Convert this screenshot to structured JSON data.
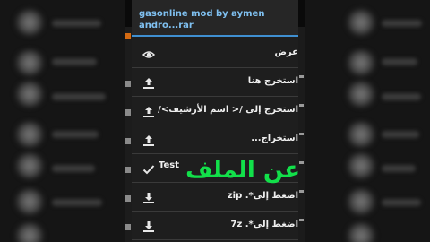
{
  "menu": {
    "title_line1": "gasonline mod by aymen",
    "title_line2": "andro...rar",
    "items": [
      {
        "label": "عرض",
        "icon": "eye-icon"
      },
      {
        "label": "استخرج هنا",
        "icon": "upload-icon"
      },
      {
        "label": "استخرج إلى /< اسم الأرشيف>/",
        "icon": "upload-icon"
      },
      {
        "label": "استخراج...",
        "icon": "upload-icon"
      },
      {
        "label": "Test",
        "icon": "check-icon"
      },
      {
        "label": "اضغط إلى*. zip",
        "icon": "download-icon"
      },
      {
        "label": "اضغط إلى*. 7z",
        "icon": "download-icon"
      }
    ]
  },
  "overlay_text": "عن الملف"
}
